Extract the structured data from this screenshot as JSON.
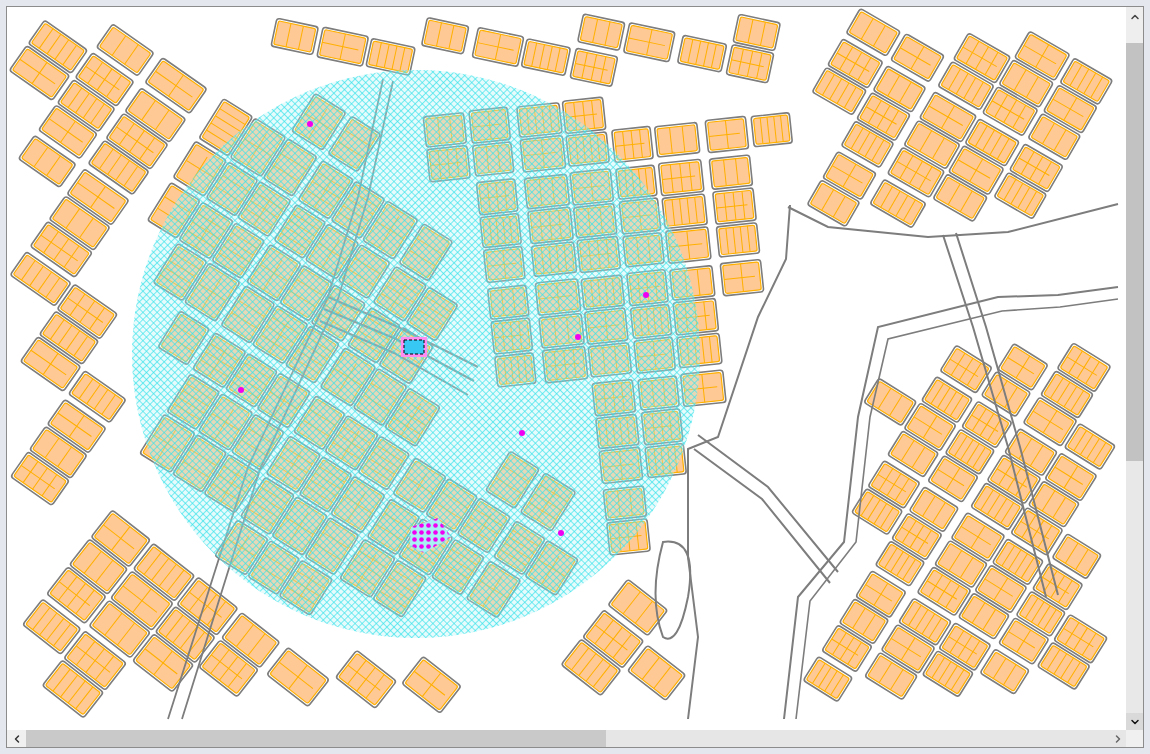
{
  "map": {
    "buffer_zone_shown": true,
    "feature_selected": true
  }
}
